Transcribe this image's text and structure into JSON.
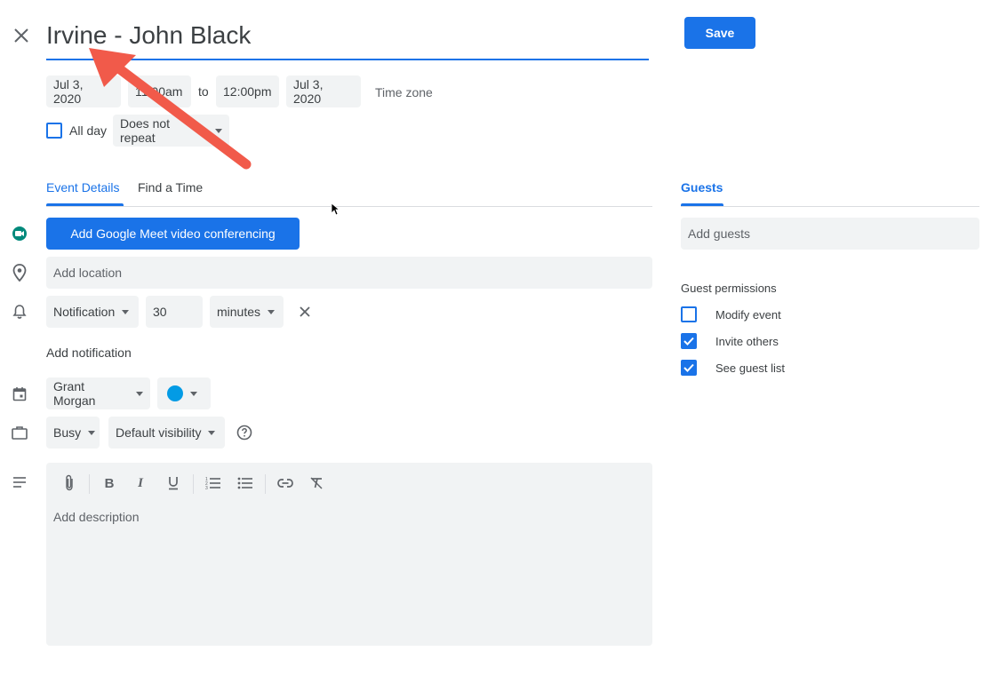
{
  "event": {
    "title": "Irvine - John Black",
    "start_date": "Jul 3, 2020",
    "start_time": "11:00am",
    "to_label": "to",
    "end_time": "12:00pm",
    "end_date": "Jul 3, 2020",
    "timezone_label": "Time zone",
    "allday_label": "All day",
    "repeat_label": "Does not repeat"
  },
  "header": {
    "save_label": "Save"
  },
  "tabs": {
    "event_details": "Event Details",
    "find_time": "Find a Time",
    "guests": "Guests"
  },
  "details": {
    "meet_button": "Add Google Meet video conferencing",
    "location_placeholder": "Add location",
    "notification_type": "Notification",
    "notification_value": "30",
    "notification_unit": "minutes",
    "add_notification": "Add notification",
    "calendar_owner": "Grant Morgan",
    "calendar_color": "#039be5",
    "availability": "Busy",
    "visibility": "Default visibility",
    "description_placeholder": "Add description"
  },
  "guests": {
    "add_placeholder": "Add guests",
    "permissions_label": "Guest permissions",
    "permissions": [
      {
        "label": "Modify event",
        "checked": false
      },
      {
        "label": "Invite others",
        "checked": true
      },
      {
        "label": "See guest list",
        "checked": true
      }
    ]
  },
  "colors": {
    "accent": "#1a73e8",
    "annotation_arrow": "#f15a4a"
  }
}
